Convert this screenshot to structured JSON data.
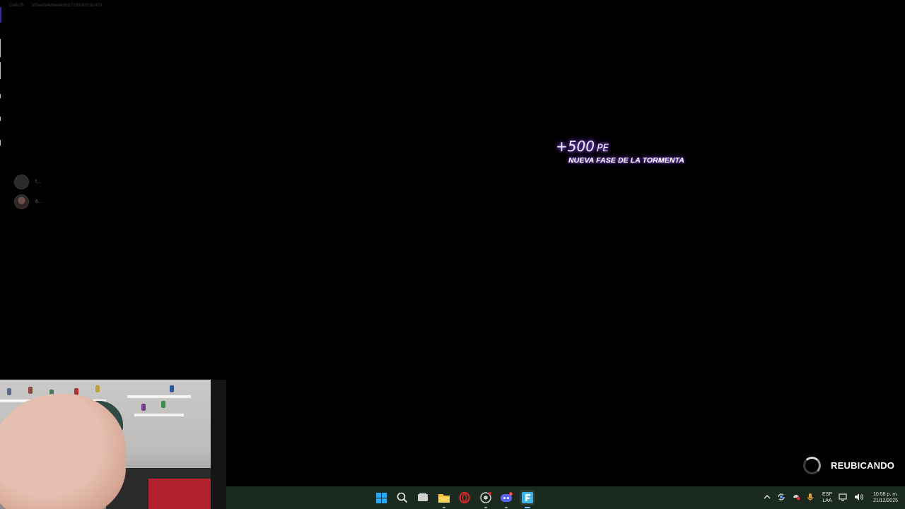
{
  "session": {
    "user_tag": "Ga6o7k",
    "session_hash": "3d5ea8a4d6eedcbcb718b5fc816c453"
  },
  "squad": {
    "members": [
      {
        "name": "f..."
      },
      {
        "name": "6..."
      }
    ]
  },
  "notification": {
    "plus": "+",
    "amount": "500",
    "unit": "PE",
    "reason": "NUEVA FASE DE LA TORMENTA",
    "glow_color": "#9b5cff"
  },
  "status": {
    "label": "REUBICANDO"
  },
  "taskbar": {
    "icons": [
      "windows-start-icon",
      "search-icon",
      "task-view-icon",
      "file-explorer-icon",
      "opera-gx-icon",
      "chrome-icon",
      "discord-icon",
      "fortnite-icon"
    ],
    "discord_badge": "9",
    "tray": {
      "language_primary": "ESP",
      "language_secondary": "LAA",
      "time": "10:58 p. m.",
      "date": "21/12/2025"
    }
  }
}
